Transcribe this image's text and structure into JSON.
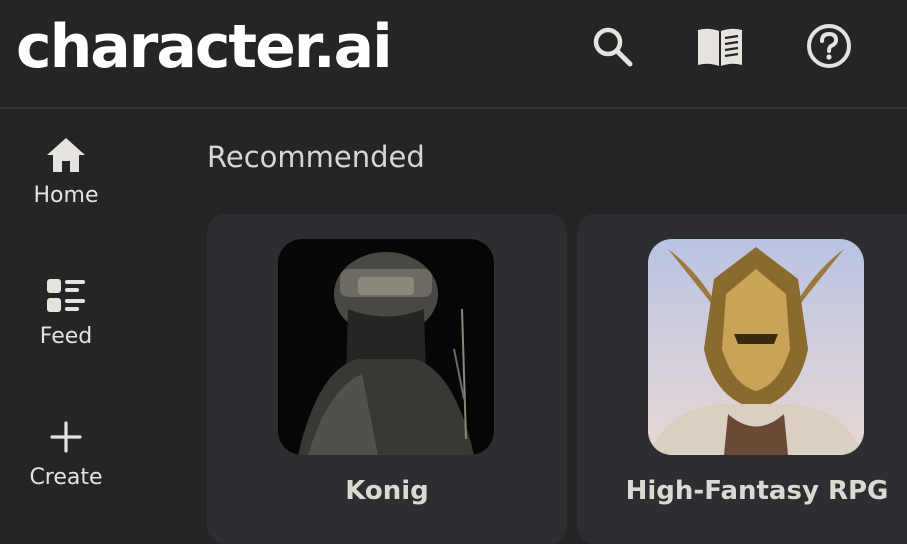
{
  "header": {
    "logo_text": "character.ai",
    "icons": [
      "search-icon",
      "book-icon",
      "help-icon"
    ]
  },
  "sidebar": {
    "items": [
      {
        "label": "Home",
        "icon": "home-icon"
      },
      {
        "label": "Feed",
        "icon": "feed-icon"
      },
      {
        "label": "Create",
        "icon": "plus-icon"
      }
    ]
  },
  "main": {
    "section_title": "Recommended",
    "cards": [
      {
        "name": "Konig"
      },
      {
        "name": "High-Fantasy RPG"
      }
    ]
  },
  "colors": {
    "background": "#242527",
    "card": "#2d2e31",
    "text": "#e6e3de",
    "divider": "#34363a"
  }
}
